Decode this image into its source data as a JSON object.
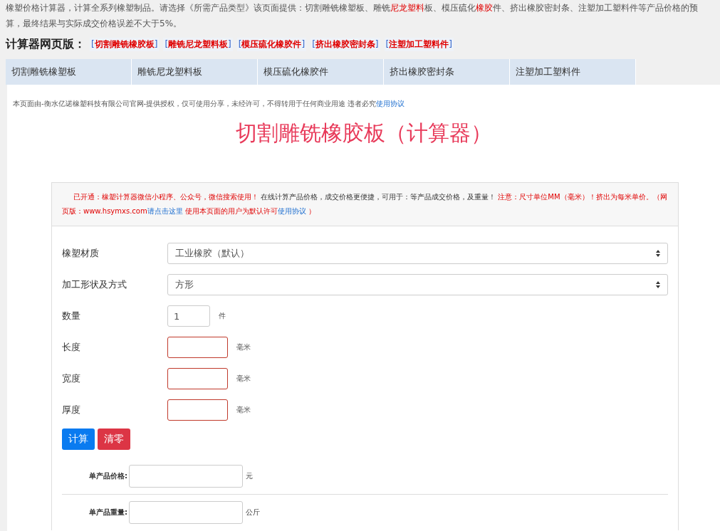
{
  "intro": [
    {
      "kind": "plain",
      "text": "橡塑价格计算器，计算全系列橡塑制品。请选择《所需产品类型》该页面提供：切割雕铣橡塑板、雕铣"
    },
    {
      "kind": "red",
      "text": "尼龙塑料"
    },
    {
      "kind": "plain",
      "text": "板、模压硫化"
    },
    {
      "kind": "red",
      "text": "橡胶"
    },
    {
      "kind": "plain",
      "text": "件、挤出橡胶密封条、注塑加工塑料件等产品价格的预算，最终结果与实际成交价格误差不大于5%。"
    }
  ],
  "web_links": {
    "title": "计算器网页版：",
    "links": [
      {
        "open": "[",
        "text": "切割雕铣橡胶板",
        "close": "]"
      },
      {
        "open": "[",
        "text": "雕铣尼龙塑料板",
        "close": "]"
      },
      {
        "open": "[",
        "text": "模压硫化橡胶件",
        "close": "]"
      },
      {
        "open": "[",
        "text": "挤出橡胶密封条",
        "close": "]"
      },
      {
        "open": "[",
        "text": "注塑加工塑料件",
        "close": "]"
      }
    ]
  },
  "tabs": [
    {
      "label": "切割雕铣橡塑板",
      "selected": false
    },
    {
      "label": "雕铣尼龙塑料板",
      "selected": false
    },
    {
      "label": "模压硫化橡胶件",
      "selected": false
    },
    {
      "label": "挤出橡胶密封条",
      "selected": false
    },
    {
      "label": "注塑加工塑料件",
      "selected": false
    }
  ],
  "copyright": {
    "text": "本页面由-衡水亿诺橡塑科技有限公司官网-提供授权，仅可使用分享，未经许可，不得转用于任何商业用途 违者必究",
    "link": "使用协议"
  },
  "heading": "切割雕铣橡胶板（计算器）",
  "notice": [
    {
      "kind": "red",
      "text": "已开通：橡塑计算器微信小程序、公众号，微信搜索使用！"
    },
    {
      "kind": "plain",
      "text": " 在线计算产品价格，成交价格更便捷，可用于：等产品成交价格，及重量！ "
    },
    {
      "kind": "red",
      "text": "注意：尺寸单位MM（毫米）！挤出为每米单价。（网页版：www.hsymxs.com"
    },
    {
      "kind": "link",
      "text": "请点击这里"
    },
    {
      "kind": "red",
      "text": " 使用本页面的用户为默认许可"
    },
    {
      "kind": "link",
      "text": "使用协议"
    },
    {
      "kind": "red",
      "text": " ）"
    }
  ],
  "form": [
    {
      "kind": "select",
      "label": "橡塑材质",
      "value": "工业橡胶（默认）"
    },
    {
      "kind": "select",
      "label": "加工形状及方式",
      "value": "方形"
    },
    {
      "kind": "input",
      "label": "数量",
      "value": "1",
      "unit": "件",
      "invalid": false
    },
    {
      "kind": "input",
      "label": "长度",
      "unit": "毫米",
      "invalid": true
    },
    {
      "kind": "input",
      "label": "宽度",
      "unit": "毫米",
      "invalid": true
    },
    {
      "kind": "input",
      "label": "厚度",
      "unit": "毫米",
      "invalid": true
    }
  ],
  "buttons": [
    {
      "kind": "primary",
      "label": "计算"
    },
    {
      "kind": "danger",
      "label": "清零"
    }
  ],
  "results": [
    {
      "label": "单产品价格:",
      "unit": "元"
    },
    {
      "label": "单产品重量:",
      "unit": "公斤"
    }
  ]
}
